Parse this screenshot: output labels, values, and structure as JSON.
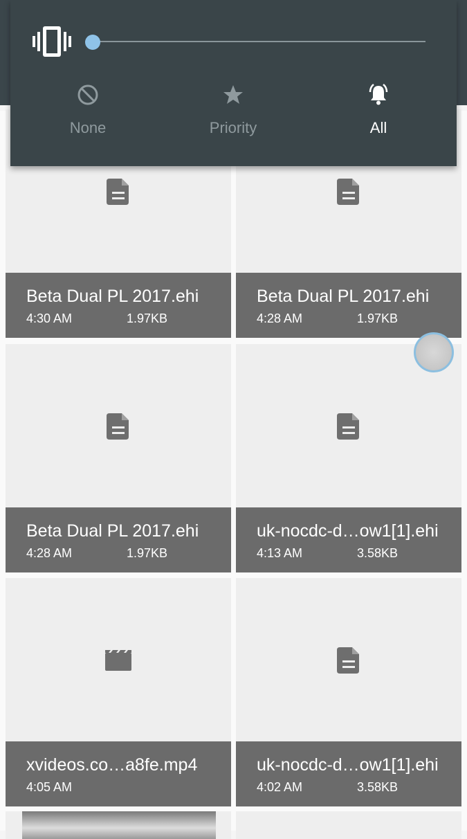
{
  "volume_panel": {
    "ringer_mode_icon": "vibrate-icon",
    "slider_level": 0,
    "modes": [
      {
        "icon": "none-icon",
        "label": "None",
        "active": false
      },
      {
        "icon": "star-icon",
        "label": "Priority",
        "active": false
      },
      {
        "icon": "bell-icon",
        "label": "All",
        "active": true
      }
    ]
  },
  "files": [
    {
      "icon": "document-icon",
      "name": "Beta Dual PL 2017.ehi",
      "time": "4:30 AM",
      "size": "1.97KB"
    },
    {
      "icon": "document-icon",
      "name": "Beta Dual PL 2017.ehi",
      "time": "4:28 AM",
      "size": "1.97KB"
    },
    {
      "icon": "document-icon",
      "name": "Beta Dual PL 2017.ehi",
      "time": "4:28 AM",
      "size": "1.97KB"
    },
    {
      "icon": "document-icon",
      "name": "uk-nocdc-d…ow1[1].ehi",
      "time": "4:13 AM",
      "size": "3.58KB"
    },
    {
      "icon": "video-icon",
      "name": "xvideos.co…a8fe.mp4",
      "time": "4:05 AM",
      "size": ""
    },
    {
      "icon": "document-icon",
      "name": "uk-nocdc-d…ow1[1].ehi",
      "time": "4:02 AM",
      "size": "3.58KB"
    }
  ],
  "colors": {
    "panel_bg": "#3a4549",
    "accent": "#8fc3e8",
    "caption_bg": "#6b6b6b",
    "tile_bg": "#eeeeee"
  }
}
